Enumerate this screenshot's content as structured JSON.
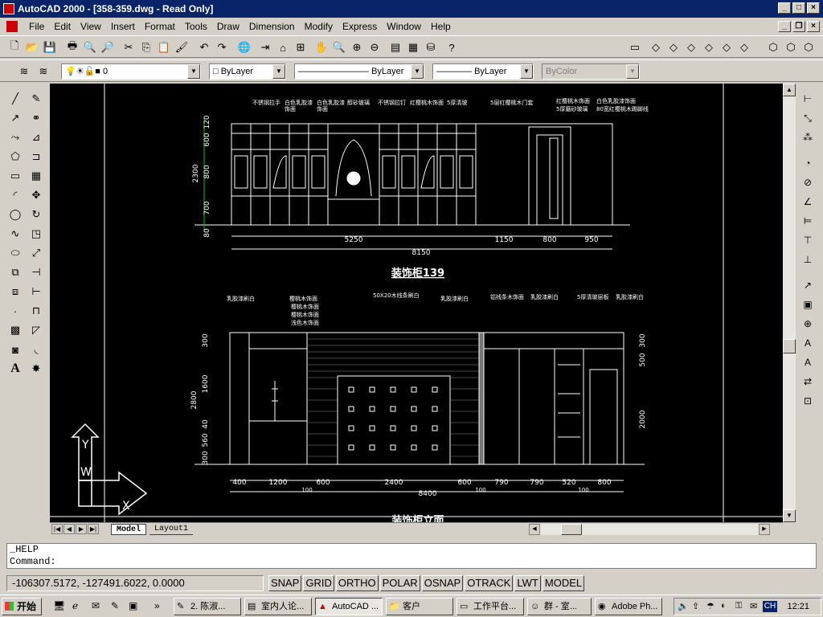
{
  "window": {
    "title": "AutoCAD 2000 - [358-359.dwg - Read Only]"
  },
  "menu": [
    "File",
    "Edit",
    "View",
    "Insert",
    "Format",
    "Tools",
    "Draw",
    "Dimension",
    "Modify",
    "Express",
    "Window",
    "Help"
  ],
  "properties": {
    "layer": "0",
    "color": "ByLayer",
    "linetype": "ByLayer",
    "lineweight": "ByLayer",
    "plotstyle": "ByColor"
  },
  "drawing": {
    "upper_title": "装饰柜139",
    "upper_labels": [
      "不锈钢拉手",
      "白色乳胶漆",
      "白色乳胶漆",
      "醇砂玻璃",
      "不锈钢拉钉",
      "红樱桃木饰面",
      "5厚清玻",
      "5层红樱桃木门套",
      "红樱桃木饰面",
      "白色乳胶漆饰面",
      "5厚磨砂玻璃",
      "80宽红樱桃木踢脚线",
      "饰面",
      "饰面"
    ],
    "upper_vdims": [
      "120",
      "600",
      "800",
      "700",
      "80"
    ],
    "upper_vtotal": "2300",
    "upper_hdims": [
      "5250",
      "1150",
      "800",
      "950"
    ],
    "upper_htotal": "8150",
    "lower_labels": [
      "乳胶漆刷白",
      "樱桃木饰面",
      "樱桃木饰面",
      "樱桃木饰面",
      "50X20木线条刷白",
      "乳胶漆刷白",
      "铝线条木饰面",
      "乳胶漆刷白",
      "5厚清玻层板",
      "乳胶漆刷白",
      "浅色木饰面"
    ],
    "lower_vdims": [
      "300",
      "1600",
      "40",
      "560",
      "300"
    ],
    "lower_vtotal": "2800",
    "lower_vdims_right": [
      "300",
      "500",
      "2000"
    ],
    "lower_hdims": [
      "400",
      "1200",
      "600",
      "2400",
      "600",
      "790",
      "790",
      "520",
      "800"
    ],
    "lower_subdims": [
      "100",
      "100",
      "100"
    ],
    "lower_htotal": "8400",
    "lower_title": "装饰柜立面",
    "ucs_y": "Y",
    "ucs_w": "W",
    "ucs_x": "X"
  },
  "tabs": {
    "model": "Model",
    "layout": "Layout1"
  },
  "command": {
    "line1": "_HELP",
    "line2": "Command:"
  },
  "status": {
    "coords": "-106307.5172, -127491.6022, 0.0000",
    "buttons": [
      "SNAP",
      "GRID",
      "ORTHO",
      "POLAR",
      "OSNAP",
      "OTRACK",
      "LWT",
      "MODEL"
    ]
  },
  "taskbar": {
    "start": "开始",
    "tasks": [
      "2. 陈淑...",
      "室内人论...",
      "AutoCAD ...",
      "客户",
      "工作平台...",
      "群 - 室...",
      "Adobe Ph..."
    ],
    "tray_lang": "CH",
    "clock": "12:21"
  }
}
